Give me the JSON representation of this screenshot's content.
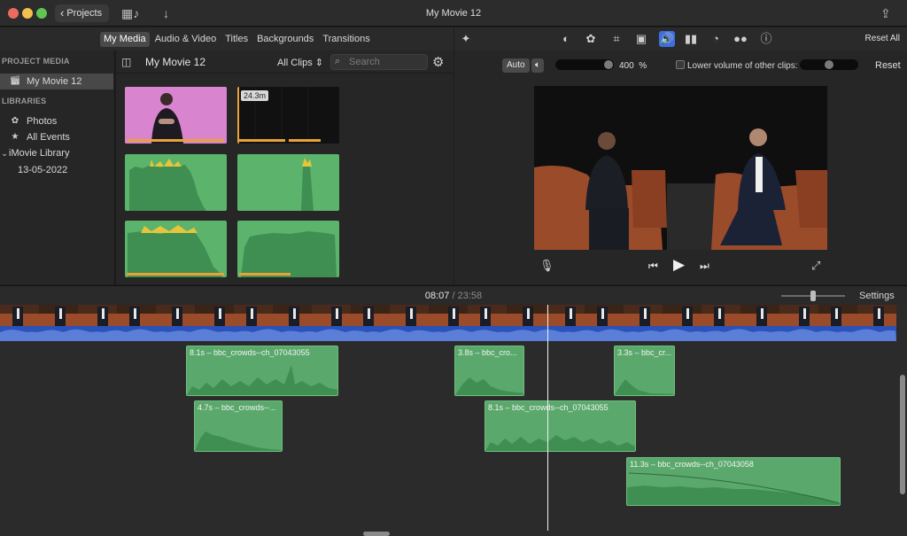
{
  "window": {
    "title": "My Movie 12",
    "projects_label": "Projects"
  },
  "browser_tabs": [
    "My Media",
    "Audio & Video",
    "Titles",
    "Backgrounds",
    "Transitions"
  ],
  "sidebar": {
    "project_media_heading": "PROJECT MEDIA",
    "project_item": "My Movie 12",
    "libraries_heading": "LIBRARIES",
    "items": [
      "Photos",
      "All Events"
    ],
    "library": "iMovie Library",
    "event": "13-05-2022"
  },
  "media_browser": {
    "title": "My Movie 12",
    "filter": "All Clips",
    "search_placeholder": "Search",
    "duration_badge": "24.3m"
  },
  "viewer": {
    "reset_all": "Reset All",
    "auto_label": "Auto",
    "volume_percent": "400",
    "volume_unit": "%",
    "volume_level": 1.0,
    "lower_volume_label": "Lower volume of other clips:",
    "reset_label": "Reset"
  },
  "timeline": {
    "current_time": "08:07",
    "separator": "/",
    "total_time": "23:58",
    "settings_label": "Settings",
    "clips": [
      "8.1s – bbc_crowds--ch_07043055",
      "3.8s – bbc_cro...",
      "3.3s – bbc_cr...",
      "4.7s – bbc_crowds--...",
      "8.1s – bbc_crowds--ch_07043055",
      "11.3s – bbc_crowds--ch_07043058"
    ]
  },
  "colors": {
    "accent": "#3d6fe0",
    "audio_clip": "#5aa86b",
    "main_audio": "#2a52b8",
    "playhead": "#f0f0f0"
  }
}
